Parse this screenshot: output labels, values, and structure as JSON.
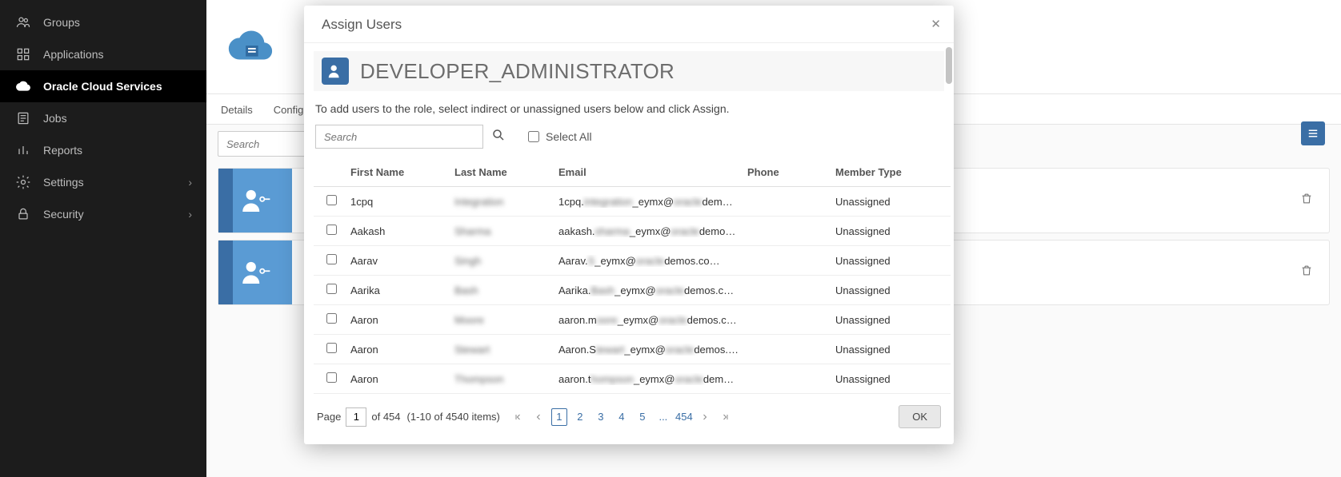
{
  "sidebar": {
    "items": [
      {
        "label": "Groups",
        "icon": "groups-icon"
      },
      {
        "label": "Applications",
        "icon": "applications-icon"
      },
      {
        "label": "Oracle Cloud Services",
        "icon": "cloud-icon"
      },
      {
        "label": "Jobs",
        "icon": "jobs-icon"
      },
      {
        "label": "Reports",
        "icon": "reports-icon"
      },
      {
        "label": "Settings",
        "icon": "settings-icon"
      },
      {
        "label": "Security",
        "icon": "security-icon"
      }
    ]
  },
  "main": {
    "tabs": [
      "Details",
      "Configuration"
    ],
    "search_placeholder": "Search"
  },
  "modal": {
    "title": "Assign Users",
    "role": "DEVELOPER_ADMINISTRATOR",
    "instruction": "To add users to the role, select indirect or unassigned users below and click Assign.",
    "search_placeholder": "Search",
    "select_all_label": "Select All",
    "columns": [
      "",
      "First Name",
      "Last Name",
      "Email",
      "Phone",
      "Member Type"
    ],
    "rows": [
      {
        "first": "1cpq",
        "last": "Integration",
        "email_vis": "1cpq.",
        "email_blur": "integration",
        "email_tail": "_eymx@",
        "email_blur2": "oracle",
        "email_end": "dem…",
        "member": "Unassigned"
      },
      {
        "first": "Aakash",
        "last": "Sharma",
        "email_vis": "aakash.",
        "email_blur": "sharma",
        "email_tail": "_eymx@",
        "email_blur2": "oracle",
        "email_end": "demo…",
        "member": "Unassigned"
      },
      {
        "first": "Aarav",
        "last": "Singh",
        "email_vis": "Aarav.",
        "email_blur": "S",
        "email_tail": "_eymx@",
        "email_blur2": "oracle",
        "email_end": "demos.co…",
        "member": "Unassigned"
      },
      {
        "first": "Aarika",
        "last": "Bash",
        "email_vis": "Aarika.",
        "email_blur": "Bash",
        "email_tail": "_eymx@",
        "email_blur2": "oracle",
        "email_end": "demos.co…",
        "member": "Unassigned"
      },
      {
        "first": "Aaron",
        "last": "Moore",
        "email_vis": "aaron.m",
        "email_blur": "oore",
        "email_tail": "_eymx@",
        "email_blur2": "oracle",
        "email_end": "demos.c…",
        "member": "Unassigned"
      },
      {
        "first": "Aaron",
        "last": "Stewart",
        "email_vis": "Aaron.S",
        "email_blur": "tewart",
        "email_tail": "_eymx@",
        "email_blur2": "oracle",
        "email_end": "demos.…",
        "member": "Unassigned"
      },
      {
        "first": "Aaron",
        "last": "Thompson",
        "email_vis": "aaron.t",
        "email_blur": "hompson",
        "email_tail": "_eymx@",
        "email_blur2": "oracle",
        "email_end": "dem…",
        "member": "Unassigned"
      }
    ],
    "footer": {
      "page_label": "Page",
      "page_value": "1",
      "of_text": "of 454",
      "range_text": "(1-10 of 4540 items)",
      "pages": [
        "1",
        "2",
        "3",
        "4",
        "5"
      ],
      "ellipsis": "...",
      "last_page": "454",
      "ok_label": "OK"
    }
  }
}
